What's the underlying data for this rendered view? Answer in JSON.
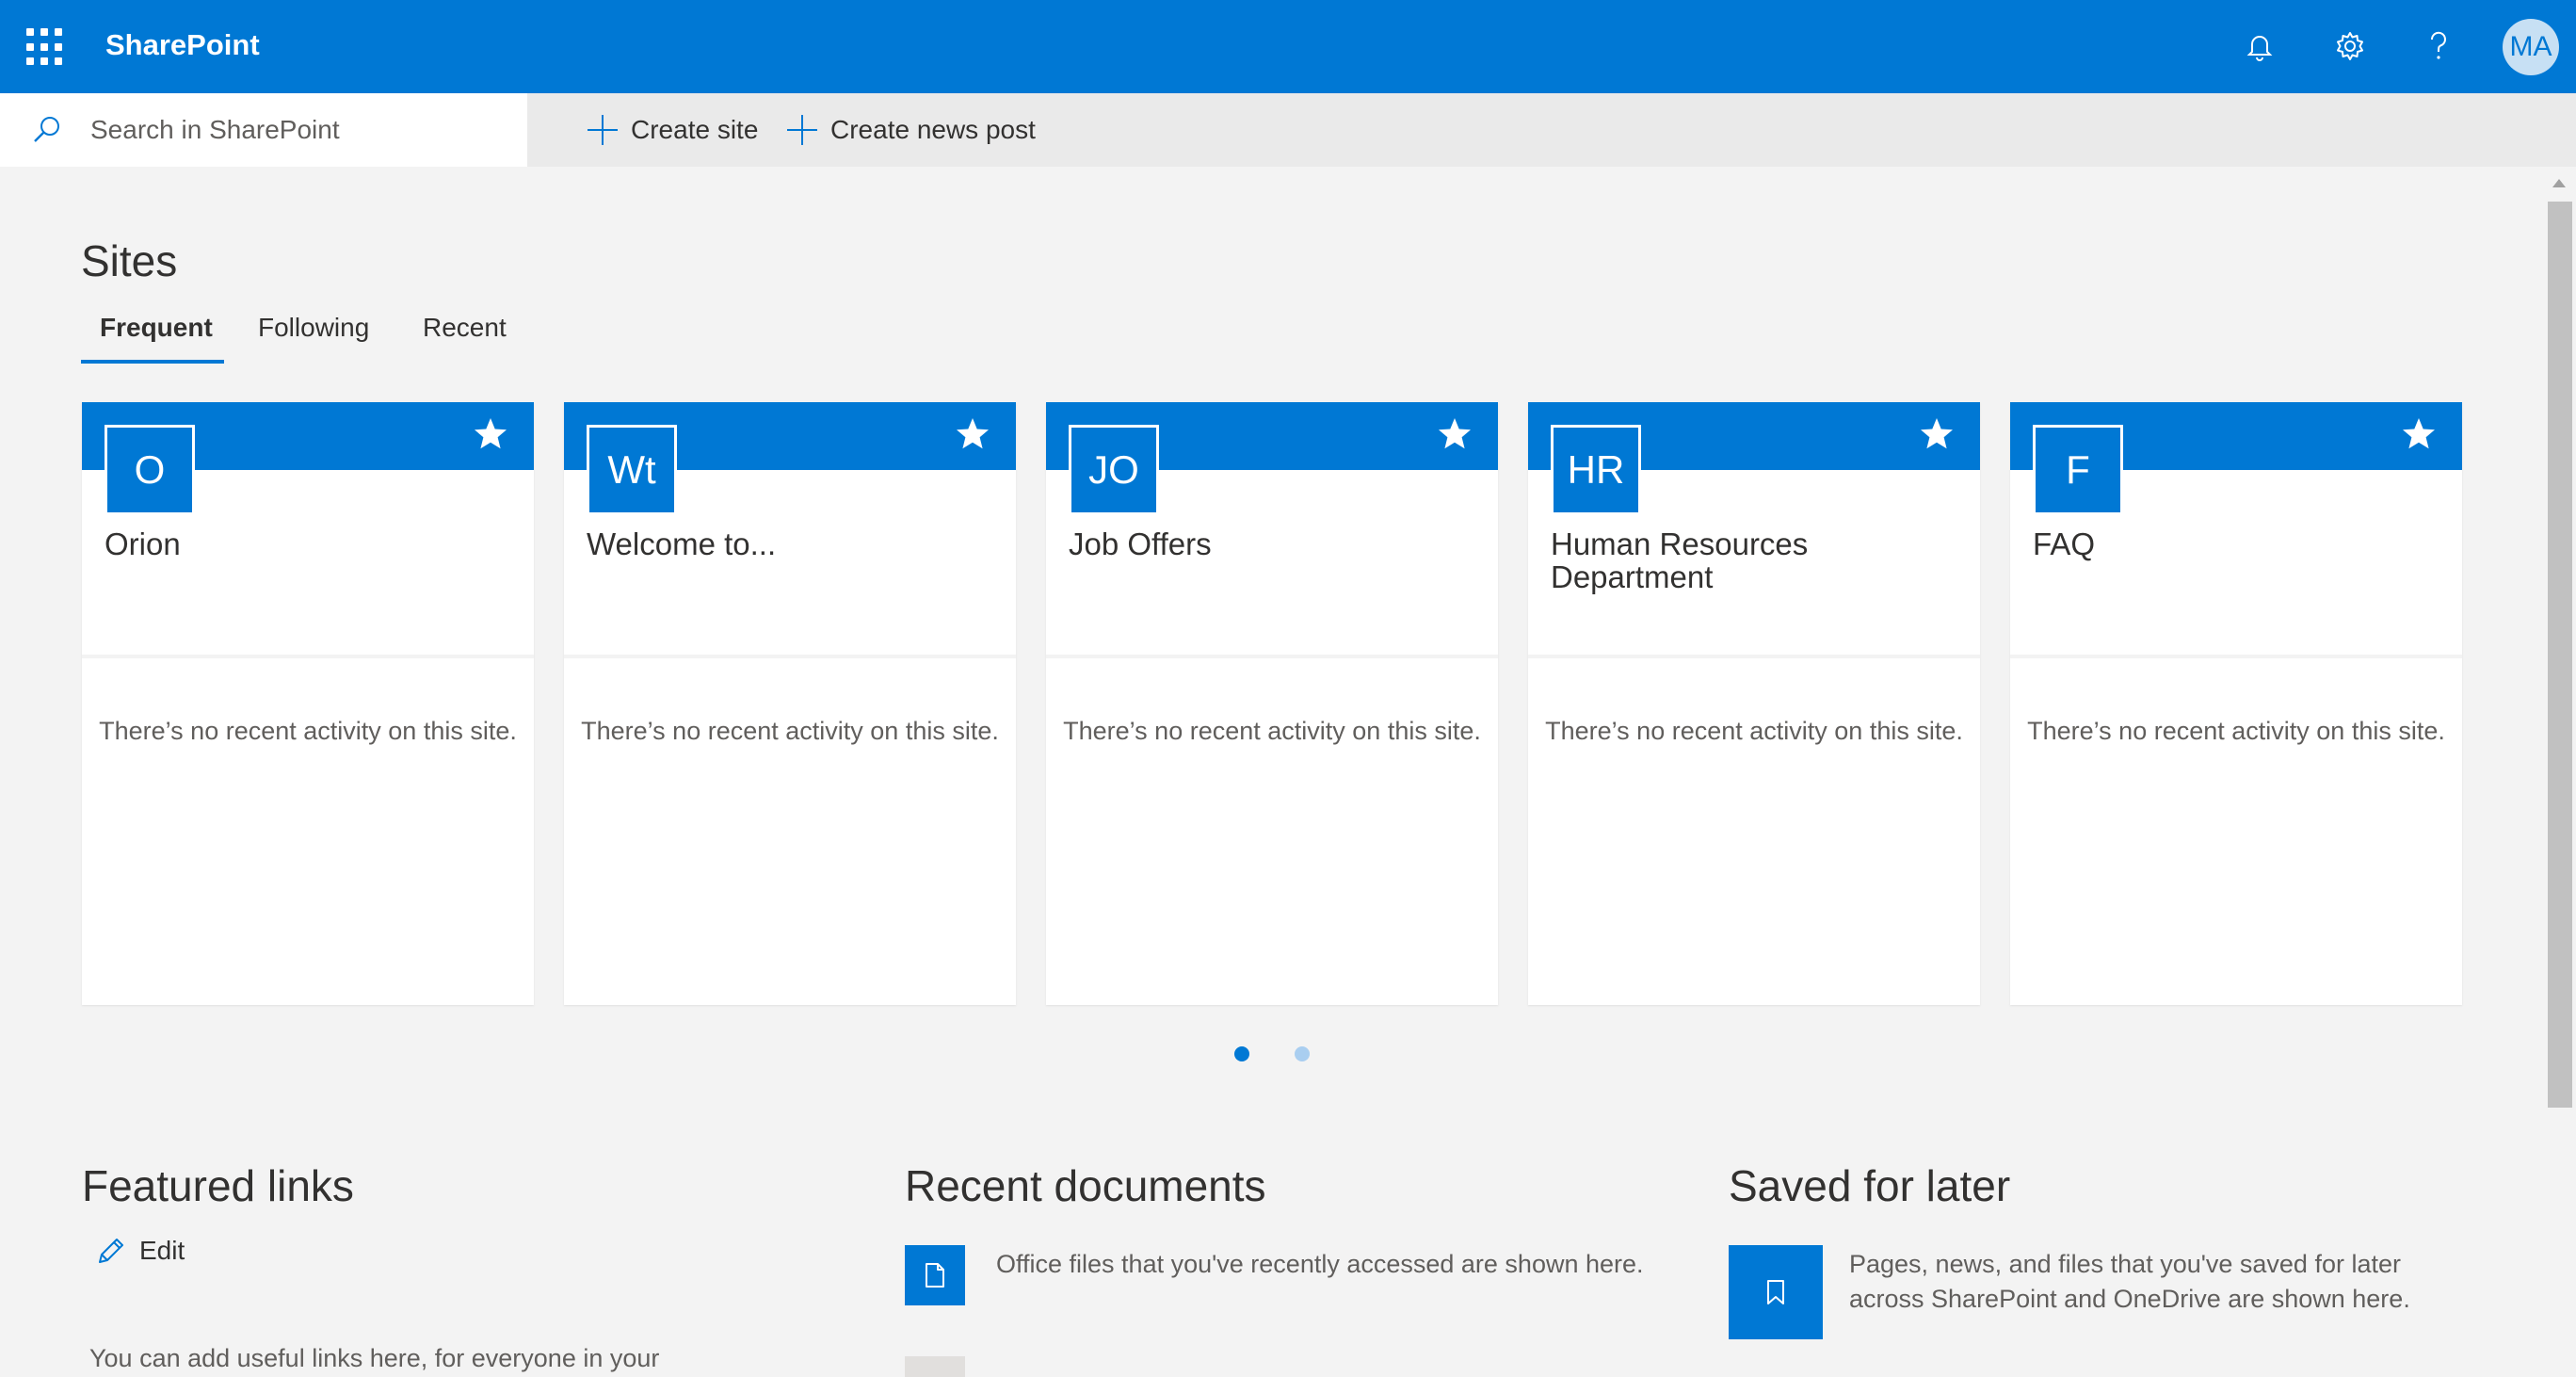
{
  "app": {
    "name": "SharePoint",
    "accent_color": "#0078d4",
    "user_initials": "MA"
  },
  "header_icons": [
    "notifications-icon",
    "settings-icon",
    "help-icon"
  ],
  "search": {
    "placeholder": "Search in SharePoint"
  },
  "commands": {
    "create_site": "Create site",
    "create_news_post": "Create news post"
  },
  "sites": {
    "heading": "Sites",
    "tabs": [
      "Frequent",
      "Following",
      "Recent"
    ],
    "active_tab": "Frequent",
    "cards": [
      {
        "initials": "O",
        "title": "Orion",
        "activity": "There’s no recent activity on this site."
      },
      {
        "initials": "Wt",
        "title": "Welcome to...",
        "activity": "There’s no recent activity on this site."
      },
      {
        "initials": "JO",
        "title": "Job Offers",
        "activity": "There’s no recent activity on this site."
      },
      {
        "initials": "HR",
        "title": "Human Resources Department",
        "activity": "There’s no recent activity on this site."
      },
      {
        "initials": "F",
        "title": "FAQ",
        "activity": "There’s no recent activity on this site."
      }
    ],
    "pagination": {
      "current_page": 1,
      "total_pages": 2
    }
  },
  "featured_links": {
    "heading": "Featured links",
    "edit_label": "Edit",
    "description": "You can add useful links here, for everyone in your"
  },
  "recent_documents": {
    "heading": "Recent documents",
    "description": "Office files that you've recently accessed are shown here."
  },
  "saved_for_later": {
    "heading": "Saved for later",
    "description": "Pages, news, and files that you've saved for later across SharePoint and OneDrive are shown here."
  }
}
